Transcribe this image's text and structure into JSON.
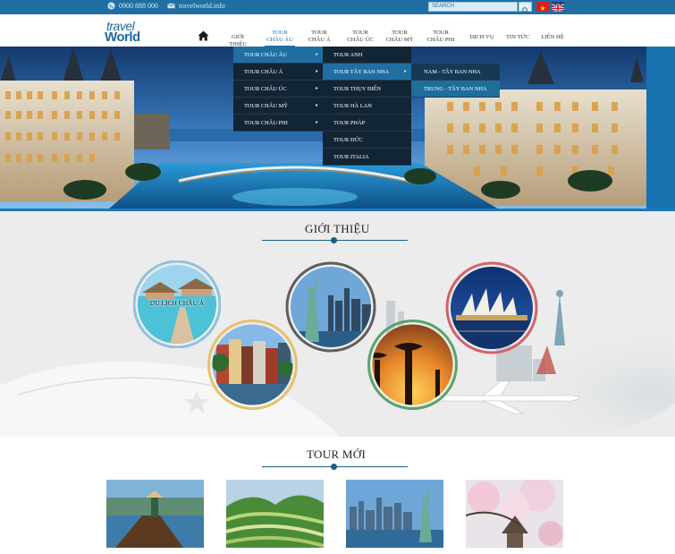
{
  "topbar": {
    "phone": "0900 888 000",
    "email": "travelworld.info",
    "search_placeholder": "SEARCH"
  },
  "logo": {
    "line1": "travel",
    "line2": "World"
  },
  "nav": {
    "items": [
      {
        "label": "GIỚI THIỆU"
      },
      {
        "label": "TOUR\nCHÂU ÂU",
        "active": true
      },
      {
        "label": "TOUR\nCHÂU Á"
      },
      {
        "label": "TOUR\nCHÂU ÚC"
      },
      {
        "label": "TOUR\nCHÂU MỸ"
      },
      {
        "label": "TOUR\nCHÂU PHI"
      },
      {
        "label": "DỊCH VỤ"
      },
      {
        "label": "TIN TỨC"
      },
      {
        "label": "LIÊN HỆ"
      }
    ]
  },
  "dropdown_level1": [
    {
      "label": "TOUR CHÂU ÂU",
      "active": true
    },
    {
      "label": "TOUR CHÂU Á"
    },
    {
      "label": "TOUR CHÂU ÚC"
    },
    {
      "label": "TOUR CHÂU MỸ"
    },
    {
      "label": "TOUR CHÂU PHI"
    }
  ],
  "dropdown_level2": [
    {
      "label": "TOUR ANH"
    },
    {
      "label": "TOUR TÂY BAN NHA",
      "active": true
    },
    {
      "label": "TOUR THỤY ĐIỂN"
    },
    {
      "label": "TOUR HÀ LAN"
    },
    {
      "label": "TOUR PHÁP"
    },
    {
      "label": "TOUR ĐỨC"
    },
    {
      "label": "TOUR ITALIA"
    }
  ],
  "dropdown_level3": [
    {
      "label": "NAM -  TÂY BAN NHA"
    },
    {
      "label": "TRUNG -  TÂY BAN NHA",
      "active": true
    }
  ],
  "intro": {
    "title": "GIỚI THIỆU",
    "circle_caption": "DU LỊCH CHÂU Á"
  },
  "tours": {
    "title": "TOUR MỚI"
  },
  "colors": {
    "brand_blue": "#1d6aa1",
    "dropdown_bg": "#122534",
    "dropdown_active": "#1f6fa3"
  }
}
